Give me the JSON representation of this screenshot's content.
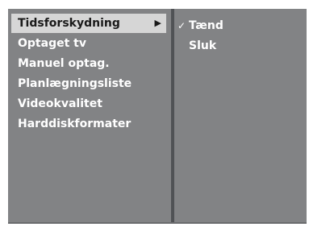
{
  "main_menu": {
    "items": [
      {
        "label": "Tidsforskydning",
        "arrow": "▶"
      },
      {
        "label": "Optaget tv"
      },
      {
        "label": "Manuel optag."
      },
      {
        "label": "Planlægningsliste"
      },
      {
        "label": "Videokvalitet"
      },
      {
        "label": "Harddiskformater"
      }
    ]
  },
  "sub_menu": {
    "items": [
      {
        "label": "Tænd",
        "check": "✓"
      },
      {
        "label": "Sluk"
      }
    ]
  }
}
